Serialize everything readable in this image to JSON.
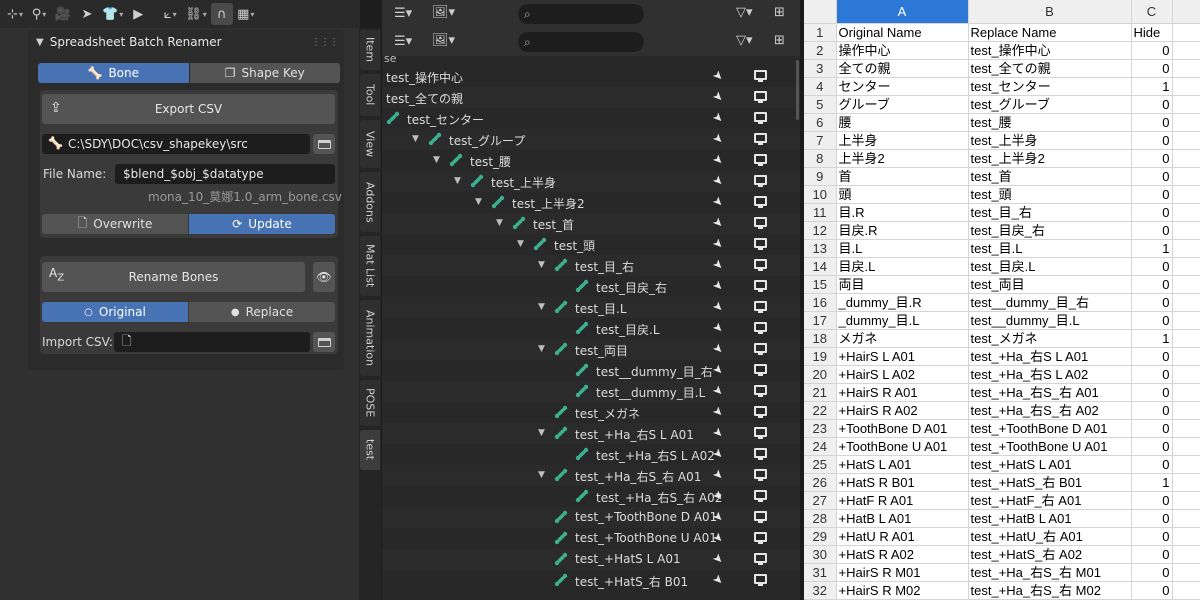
{
  "blender": {
    "panel_title": "Spreadsheet Batch Renamer",
    "datatype_tabs": [
      {
        "label": "Bone",
        "active": true
      },
      {
        "label": "Shape Key",
        "active": false
      }
    ],
    "export_button": "Export CSV",
    "path_value": "C:\\SDY\\DOC\\csv_shapekey\\src",
    "file_name_label": "File Name:",
    "file_name_value": "$blend_$obj_$datatype",
    "resolved_name": "mona_10_莫娜1.0_arm_bone.csv",
    "write_modes": [
      {
        "label": "Overwrite",
        "active": false
      },
      {
        "label": "Update",
        "active": true
      }
    ],
    "rename_button": "Rename Bones",
    "rename_az": "A",
    "rename_z": "Z",
    "source_modes": [
      {
        "label": "Original",
        "active": true
      },
      {
        "label": "Replace",
        "active": false
      }
    ],
    "import_label": "Import CSV:",
    "vertical_tabs": [
      "Item",
      "Tool",
      "View",
      "Addons",
      "Mat List",
      "Animation",
      "POSE",
      "test"
    ],
    "accent": "#4772b3"
  },
  "outliner": {
    "filter_peek": "se",
    "rows": [
      {
        "name": "test_操作中心",
        "depth": 0,
        "bone": false,
        "arrow": false
      },
      {
        "name": "test_全ての親",
        "depth": 0,
        "bone": false,
        "arrow": false
      },
      {
        "name": "test_センター",
        "depth": 0,
        "bone": true,
        "arrow": false
      },
      {
        "name": "test_グループ",
        "depth": 1,
        "bone": true,
        "arrow": true
      },
      {
        "name": "test_腰",
        "depth": 2,
        "bone": true,
        "arrow": true
      },
      {
        "name": "test_上半身",
        "depth": 3,
        "bone": true,
        "arrow": true
      },
      {
        "name": "test_上半身2",
        "depth": 4,
        "bone": true,
        "arrow": true
      },
      {
        "name": "test_首",
        "depth": 5,
        "bone": true,
        "arrow": true
      },
      {
        "name": "test_頭",
        "depth": 6,
        "bone": true,
        "arrow": true
      },
      {
        "name": "test_目_右",
        "depth": 7,
        "bone": true,
        "arrow": true
      },
      {
        "name": "test_目戻_右",
        "depth": 8,
        "bone": true,
        "arrow": false
      },
      {
        "name": "test_目.L",
        "depth": 7,
        "bone": true,
        "arrow": true
      },
      {
        "name": "test_目戻.L",
        "depth": 8,
        "bone": true,
        "arrow": false
      },
      {
        "name": "test_両目",
        "depth": 7,
        "bone": true,
        "arrow": true
      },
      {
        "name": "test__dummy_目_右",
        "depth": 8,
        "bone": true,
        "arrow": false
      },
      {
        "name": "test__dummy_目.L",
        "depth": 8,
        "bone": true,
        "arrow": false
      },
      {
        "name": "test_メガネ",
        "depth": 7,
        "bone": true,
        "arrow": false
      },
      {
        "name": "test_+Ha_右S L A01",
        "depth": 7,
        "bone": true,
        "arrow": true
      },
      {
        "name": "test_+Ha_右S L A02",
        "depth": 8,
        "bone": true,
        "arrow": false
      },
      {
        "name": "test_+Ha_右S_右 A01",
        "depth": 7,
        "bone": true,
        "arrow": true
      },
      {
        "name": "test_+Ha_右S_右 A02",
        "depth": 8,
        "bone": true,
        "arrow": false
      },
      {
        "name": "test_+ToothBone D A01",
        "depth": 7,
        "bone": true,
        "arrow": false
      },
      {
        "name": "test_+ToothBone U A01",
        "depth": 7,
        "bone": true,
        "arrow": false
      },
      {
        "name": "test_+HatS L A01",
        "depth": 7,
        "bone": true,
        "arrow": false
      },
      {
        "name": "test_+HatS_右 B01",
        "depth": 7,
        "bone": true,
        "arrow": false
      }
    ]
  },
  "sheet": {
    "columns": [
      "A",
      "B",
      "C"
    ],
    "rows": [
      [
        "Original Name",
        "Replace Name",
        "Hide"
      ],
      [
        "操作中心",
        "test_操作中心",
        "0"
      ],
      [
        "全ての親",
        "test_全ての親",
        "0"
      ],
      [
        "センター",
        "test_センター",
        "1"
      ],
      [
        "グルーブ",
        "test_グルーブ",
        "0"
      ],
      [
        "腰",
        "test_腰",
        "0"
      ],
      [
        "上半身",
        "test_上半身",
        "0"
      ],
      [
        "上半身2",
        "test_上半身2",
        "0"
      ],
      [
        "首",
        "test_首",
        "0"
      ],
      [
        "頭",
        "test_頭",
        "0"
      ],
      [
        "目.R",
        "test_目_右",
        "0"
      ],
      [
        "目戻.R",
        "test_目戻_右",
        "0"
      ],
      [
        "目.L",
        "test_目.L",
        "1"
      ],
      [
        "目戻.L",
        "test_目戻.L",
        "0"
      ],
      [
        "両目",
        "test_両目",
        "0"
      ],
      [
        "_dummy_目.R",
        "test__dummy_目_右",
        "0"
      ],
      [
        "_dummy_目.L",
        "test__dummy_目.L",
        "0"
      ],
      [
        "メガネ",
        "test_メガネ",
        "1"
      ],
      [
        "+HairS L A01",
        "test_+Ha_右S L A01",
        "0"
      ],
      [
        "+HairS L A02",
        "test_+Ha_右S L A02",
        "0"
      ],
      [
        "+HairS R A01",
        "test_+Ha_右S_右 A01",
        "0"
      ],
      [
        "+HairS R A02",
        "test_+Ha_右S_右 A02",
        "0"
      ],
      [
        "+ToothBone D A01",
        "test_+ToothBone D A01",
        "0"
      ],
      [
        "+ToothBone U A01",
        "test_+ToothBone U A01",
        "0"
      ],
      [
        "+HatS L A01",
        "test_+HatS L A01",
        "0"
      ],
      [
        "+HatS R B01",
        "test_+HatS_右 B01",
        "1"
      ],
      [
        "+HatF R A01",
        "test_+HatF_右 A01",
        "0"
      ],
      [
        "+HatB L A01",
        "test_+HatB L A01",
        "0"
      ],
      [
        "+HatU R A01",
        "test_+HatU_右 A01",
        "0"
      ],
      [
        "+HatS R A02",
        "test_+HatS_右 A02",
        "0"
      ],
      [
        "+HairS R M01",
        "test_+Ha_右S_右 M01",
        "0"
      ],
      [
        "+HairS R M02",
        "test_+Ha_右S_右 M02",
        "0"
      ]
    ],
    "selected_column": "A"
  }
}
